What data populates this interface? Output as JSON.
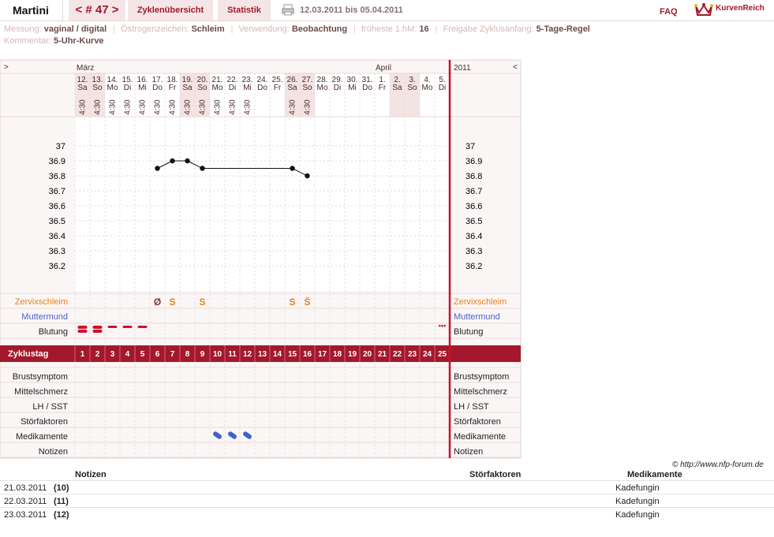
{
  "nav": {
    "user": "Martini",
    "cycle": "< # 47 >",
    "overview": "Zyklenübersicht",
    "stats": "Statistik",
    "daterange": "12.03.2011 bis 05.04.2011",
    "faq": "FAQ",
    "logo": "KurvenReich"
  },
  "meta": {
    "l1": "Messung:",
    "v1": "vaginal / digital",
    "l2": "Östrogenzeichen:",
    "v2": "Schleim",
    "l3": "Verwendung:",
    "v3": "Beobachtung",
    "l4": "früheste 1.hM:",
    "v4": "16",
    "l5": "Freigabe Zyklusanfang:",
    "v5": "5-Tage-Regel",
    "l6": "Kommentar:",
    "v6": "5-Uhr-Kurve"
  },
  "chart_data": {
    "type": "line",
    "header": {
      "left_arrow": ">",
      "right_arrow": "<",
      "month1": "März",
      "month2": "April",
      "year": "2011"
    },
    "dates": [
      "12.",
      "13.",
      "14.",
      "15.",
      "16.",
      "17.",
      "18.",
      "19.",
      "20.",
      "21.",
      "22.",
      "23.",
      "24.",
      "25.",
      "26.",
      "27.",
      "28.",
      "29.",
      "30.",
      "31.",
      "1.",
      "2.",
      "3.",
      "4.",
      "5."
    ],
    "weekdays": [
      "Sa",
      "So",
      "Mo",
      "Di",
      "Mi",
      "Do",
      "Fr",
      "Sa",
      "So",
      "Mo",
      "Di",
      "Mi",
      "Do",
      "Fr",
      "Sa",
      "So",
      "Mo",
      "Di",
      "Mi",
      "Do",
      "Fr",
      "Sa",
      "So",
      "Mo",
      "Di"
    ],
    "times": [
      "4:30",
      "4:30",
      "4:30",
      "4:30",
      "4:30",
      "4:30",
      "4:30",
      "4:30",
      "4:30",
      "4:30",
      "4:30",
      "4:30",
      "",
      "",
      "4:30",
      "4:30",
      "",
      "",
      "",
      "",
      "",
      "",
      "",
      "",
      ""
    ],
    "ylabels": [
      "37",
      "36.9",
      "36.8",
      "36.7",
      "36.6",
      "36.5",
      "36.4",
      "36.3",
      "36.2"
    ],
    "temps": [
      null,
      null,
      null,
      null,
      null,
      36.85,
      36.9,
      36.9,
      36.85,
      null,
      null,
      null,
      null,
      null,
      36.85,
      36.8,
      null,
      null,
      null,
      null,
      null,
      null,
      null,
      null,
      null
    ],
    "cervix": [
      "",
      "",
      "",
      "",
      "",
      "Ø",
      "S",
      "",
      "S",
      "",
      "",
      "",
      "",
      "",
      "S",
      "S̈",
      "",
      "",
      "",
      "",
      "",
      "",
      "",
      "",
      ""
    ],
    "bleeding": [
      2,
      2,
      1,
      1,
      1,
      0,
      0,
      0,
      0,
      0,
      0,
      0,
      0,
      0,
      0,
      0,
      0,
      0,
      0,
      0,
      0,
      0,
      0,
      0,
      3
    ],
    "meds": [
      0,
      0,
      0,
      0,
      0,
      0,
      0,
      0,
      0,
      1,
      1,
      1,
      0,
      0,
      0,
      0,
      0,
      0,
      0,
      0,
      0,
      0,
      0,
      0,
      0
    ],
    "cycleday_label": "Zyklustag",
    "rows": {
      "cervix": "Zervixschleim",
      "mouth": "Muttermund",
      "bleed": "Blutung",
      "breast": "Brustsymptom",
      "midpain": "Mittelschmerz",
      "lh": "LH / SST",
      "disturb": "Störfaktoren",
      "meds": "Medikamente",
      "notes": "Notizen"
    }
  },
  "colors": {
    "accent": "#a3182c",
    "weekend": "#f3e3e3",
    "cervix": "#e9811a",
    "muttermund": "#4c62c8",
    "blood": "#d0102a",
    "pill": "#3f62d0"
  },
  "copyright": "© http://www.nfp-forum.de",
  "table": {
    "h_notes": "Notizen",
    "h_dist": "Störfaktoren",
    "h_meds": "Medikamente",
    "rows": [
      {
        "date": "21.03.2011",
        "day": "(10)",
        "med": "Kadefungin"
      },
      {
        "date": "22.03.2011",
        "day": "(11)",
        "med": "Kadefungin"
      },
      {
        "date": "23.03.2011",
        "day": "(12)",
        "med": "Kadefungin"
      }
    ]
  }
}
